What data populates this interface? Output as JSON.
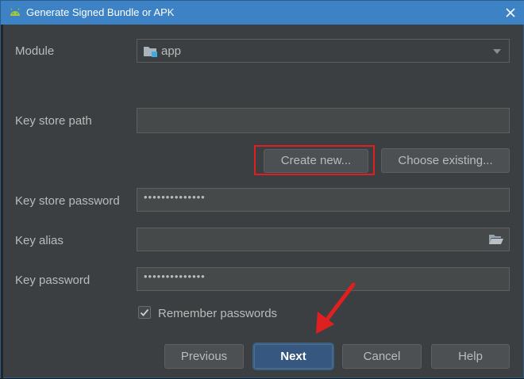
{
  "window": {
    "title": "Generate Signed Bundle or APK",
    "close_icon": "close-icon",
    "colors": {
      "titlebar": "#3c82c4",
      "background": "#3c3f41",
      "field": "#45494a",
      "primary": "#365880",
      "annotation": "#e02020"
    }
  },
  "form": {
    "module_label": "Module",
    "module_value": "app",
    "key_store_path_label": "Key store path",
    "key_store_path_value": "",
    "create_new_label": "Create new...",
    "choose_existing_label": "Choose existing...",
    "key_store_password_label": "Key store password",
    "key_store_password_value": "••••••••••••••",
    "key_alias_label": "Key alias",
    "key_alias_value": "",
    "key_password_label": "Key password",
    "key_password_value": "••••••••••••••",
    "remember_label": "Remember passwords",
    "remember_checked": true
  },
  "footer": {
    "previous_label": "Previous",
    "next_label": "Next",
    "cancel_label": "Cancel",
    "help_label": "Help"
  }
}
